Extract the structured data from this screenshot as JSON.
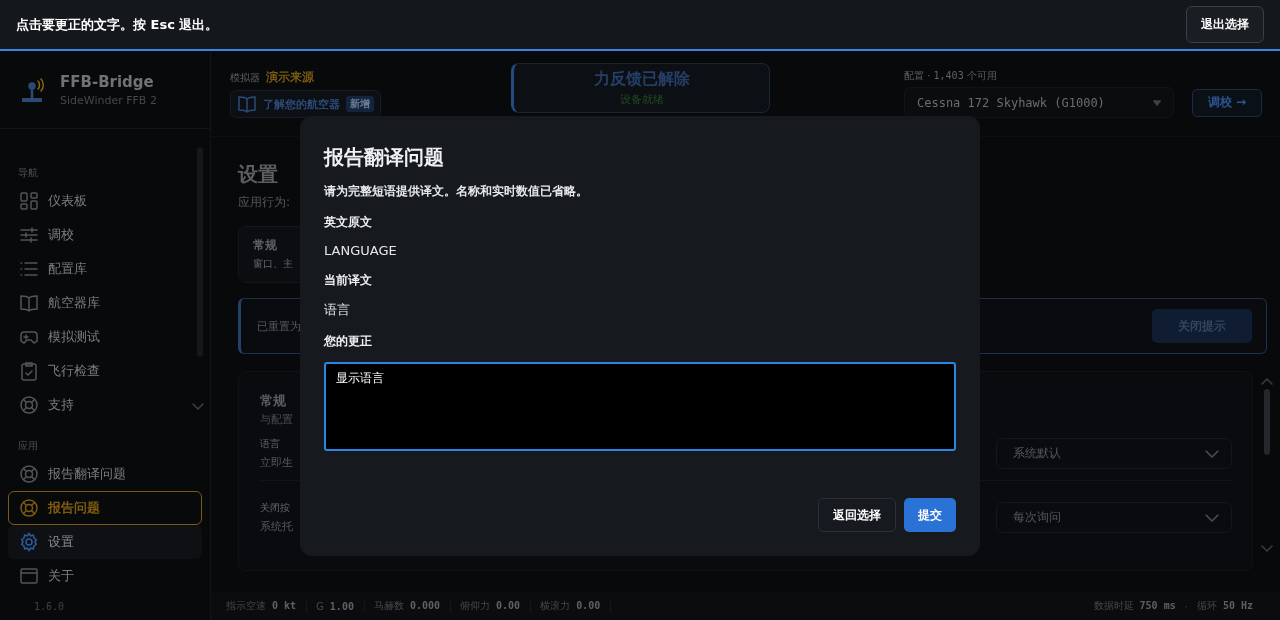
{
  "picker_bar": {
    "instruction": "点击要更正的文字。按 Esc 退出。",
    "button": "退出选择"
  },
  "brand": {
    "name": "FFB-Bridge",
    "device": "SideWinder FFB 2"
  },
  "header": {
    "simulator_label": "模拟器",
    "simulator_value": "演示来源",
    "aircraft_button": "了解您的航空器",
    "aircraft_badge": "新增",
    "status_title": "力反馈已解除",
    "status_sub": "设备就绪",
    "profile_label": "配置 · ",
    "profile_count": "1,403",
    "profile_suffix": "个可用",
    "profile_select": "Cessna 172 Skyhawk (G1000)",
    "calibrate_button": "调校",
    "calibrate_arrow": "→"
  },
  "sidebar": {
    "sections": [
      {
        "title": "导航",
        "items": [
          {
            "label": "仪表板",
            "kind": "grid",
            "selected": false,
            "highlighted": false,
            "has_submenu": false
          },
          {
            "label": "调校",
            "kind": "sliders",
            "selected": false,
            "highlighted": false,
            "has_submenu": false
          },
          {
            "label": "配置库",
            "kind": "list",
            "selected": false,
            "highlighted": false,
            "has_submenu": false
          },
          {
            "label": "航空器库",
            "kind": "book",
            "selected": false,
            "highlighted": false,
            "has_submenu": false
          },
          {
            "label": "模拟测试",
            "kind": "gamepad",
            "selected": false,
            "highlighted": false,
            "has_submenu": false
          },
          {
            "label": "飞行检查",
            "kind": "clipboard",
            "selected": false,
            "highlighted": false,
            "has_submenu": false
          },
          {
            "label": "支持",
            "kind": "lifebuoy",
            "selected": false,
            "highlighted": false,
            "has_submenu": true
          }
        ]
      },
      {
        "title": "应用",
        "items": [
          {
            "label": "报告翻译问题",
            "kind": "lifebuoy",
            "selected": false,
            "highlighted": false,
            "has_submenu": false
          },
          {
            "label": "报告问题",
            "kind": "lifebuoy",
            "selected": false,
            "highlighted": true,
            "has_submenu": false
          },
          {
            "label": "设置",
            "kind": "gear",
            "selected": true,
            "highlighted": false,
            "has_submenu": false
          },
          {
            "label": "关于",
            "kind": "window",
            "selected": false,
            "highlighted": false,
            "has_submenu": false
          }
        ]
      }
    ],
    "version": "1.6.0"
  },
  "page": {
    "title": "设置",
    "subtitle": "应用行为:",
    "category_card": {
      "title": "常规",
      "text": "窗口、主"
    },
    "notice": {
      "text": "已重置为",
      "button": "关闭提示"
    },
    "panel": {
      "title": "常规",
      "subtitle": "与配置",
      "rows": [
        {
          "label": "语言",
          "description": "立即生",
          "select": "系统默认"
        },
        {
          "label": "关闭按",
          "description": "系统托",
          "select": "每次询问"
        }
      ]
    }
  },
  "status_bar": {
    "left": [
      {
        "label": "指示空速",
        "value": "0 kt"
      },
      {
        "label": "G",
        "value": "1.00"
      },
      {
        "label": "马赫数",
        "value": "0.000"
      },
      {
        "label": "俯仰力",
        "value": "0.00"
      },
      {
        "label": "横滚力",
        "value": "0.00"
      }
    ],
    "right": [
      {
        "label": "数据时延",
        "value": "750 ms"
      },
      {
        "label": "循环",
        "value": "50 Hz"
      }
    ],
    "separator": "·"
  },
  "dialog": {
    "title": "报告翻译问题",
    "description": "请为完整短语提供译文。名称和实时数值已省略。",
    "sections": [
      {
        "label": "英文原文",
        "text": "LANGUAGE"
      },
      {
        "label": "当前译文",
        "text": "语言"
      }
    ],
    "correction": {
      "label": "您的更正",
      "value": "显示语言"
    },
    "buttons": [
      {
        "label": "返回选择",
        "kind": "secondary"
      },
      {
        "label": "提交",
        "kind": "primary"
      }
    ]
  }
}
